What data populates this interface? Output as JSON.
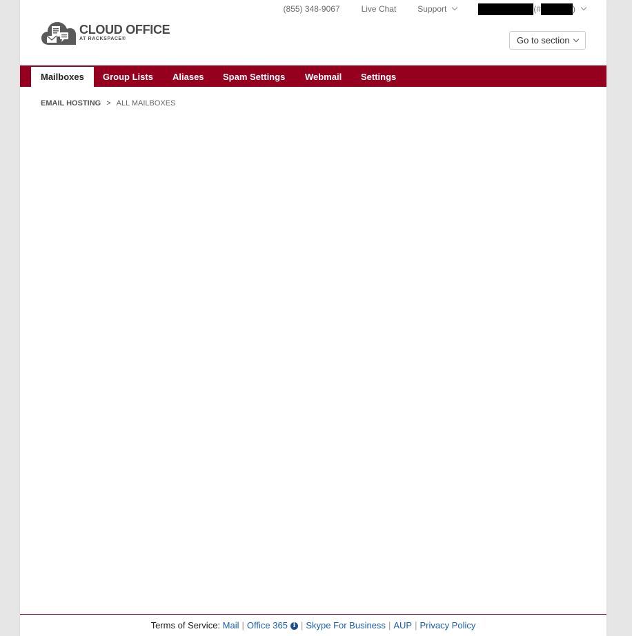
{
  "utility": {
    "phone": "(855) 348-9067",
    "live_chat": "Live Chat",
    "support": "Support",
    "account_paren_open": "(#",
    "account_paren_close": ")"
  },
  "logo": {
    "main": "CLOUD OFFICE",
    "sub": "AT RACKSPACE®"
  },
  "goto_section": "Go to section",
  "nav": {
    "tabs": [
      {
        "label": "Mailboxes",
        "active": true
      },
      {
        "label": "Group Lists",
        "active": false
      },
      {
        "label": "Aliases",
        "active": false
      },
      {
        "label": "Spam Settings",
        "active": false
      },
      {
        "label": "Webmail",
        "active": false
      },
      {
        "label": "Settings",
        "active": false
      }
    ]
  },
  "breadcrumb": {
    "root": "EMAIL HOSTING",
    "separator": ">",
    "current": "ALL MAILBOXES"
  },
  "footer": {
    "prefix": "Terms of Service:",
    "links": [
      "Mail",
      "Office 365",
      "Skype For Business",
      "AUP",
      "Privacy Policy"
    ],
    "info_icon_glyph": "i"
  },
  "colors": {
    "brand": "#95001f",
    "link": "#1a5fb4"
  }
}
